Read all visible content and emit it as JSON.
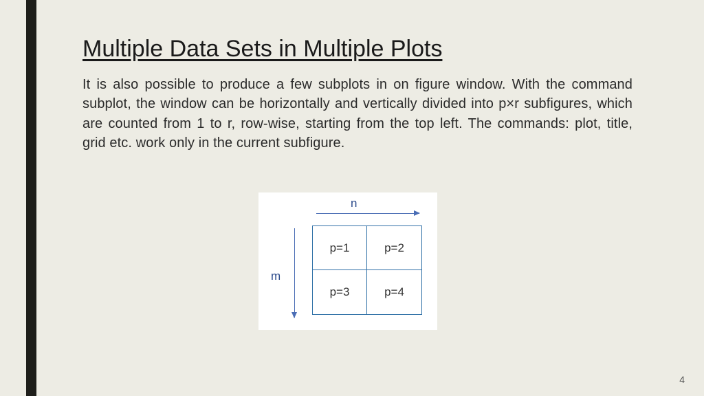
{
  "slide": {
    "title": "Multiple Data Sets in Multiple Plots",
    "body": "It is also possible to produce a few subplots in on figure window. With the command subplot, the window can be horizontally and vertically divided into p×r subfigures, which are counted from 1 to r, row-wise, starting from the top left. The commands: plot, title, grid  etc. work only in the current subfigure.",
    "page_number": "4"
  },
  "diagram": {
    "col_label": "n",
    "row_label": "m",
    "cells": [
      "p=1",
      "p=2",
      "p=3",
      "p=4"
    ]
  }
}
